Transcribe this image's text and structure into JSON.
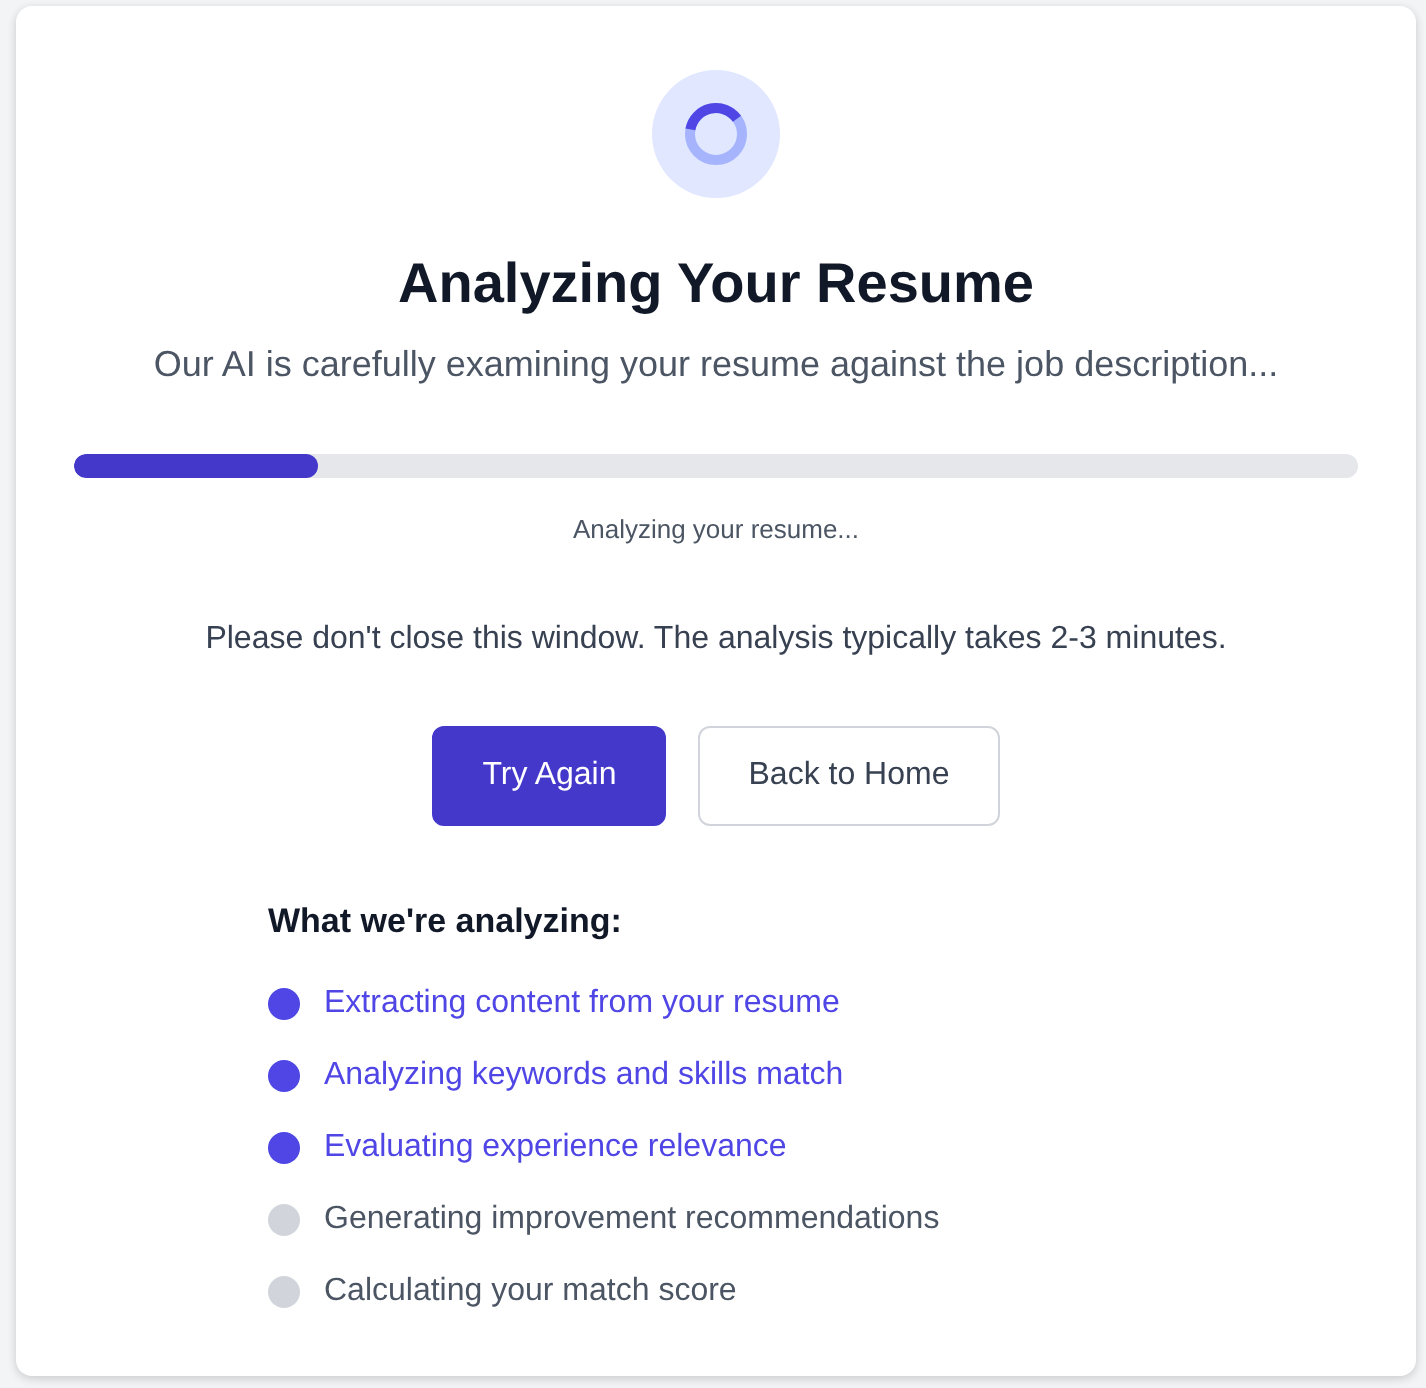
{
  "title": "Analyzing Your Resume",
  "subtitle": "Our AI is carefully examining your resume against the job description...",
  "progress": {
    "level": 0.19,
    "label": "Analyzing your resume..."
  },
  "note": "Please don't close this window. The analysis typically takes 2-3 minutes.",
  "buttons": [
    {
      "label": "Try Again",
      "kind": "primary"
    },
    {
      "label": "Back to Home",
      "kind": "secondary"
    }
  ],
  "checklist": {
    "heading": "What we're analyzing:",
    "steps": [
      {
        "label": "Extracting content from your resume",
        "done": true
      },
      {
        "label": "Analyzing keywords and skills match",
        "done": true
      },
      {
        "label": "Evaluating experience relevance",
        "done": true
      },
      {
        "label": "Generating improvement recommendations",
        "done": false
      },
      {
        "label": "Calculating your match score",
        "done": false
      }
    ]
  }
}
